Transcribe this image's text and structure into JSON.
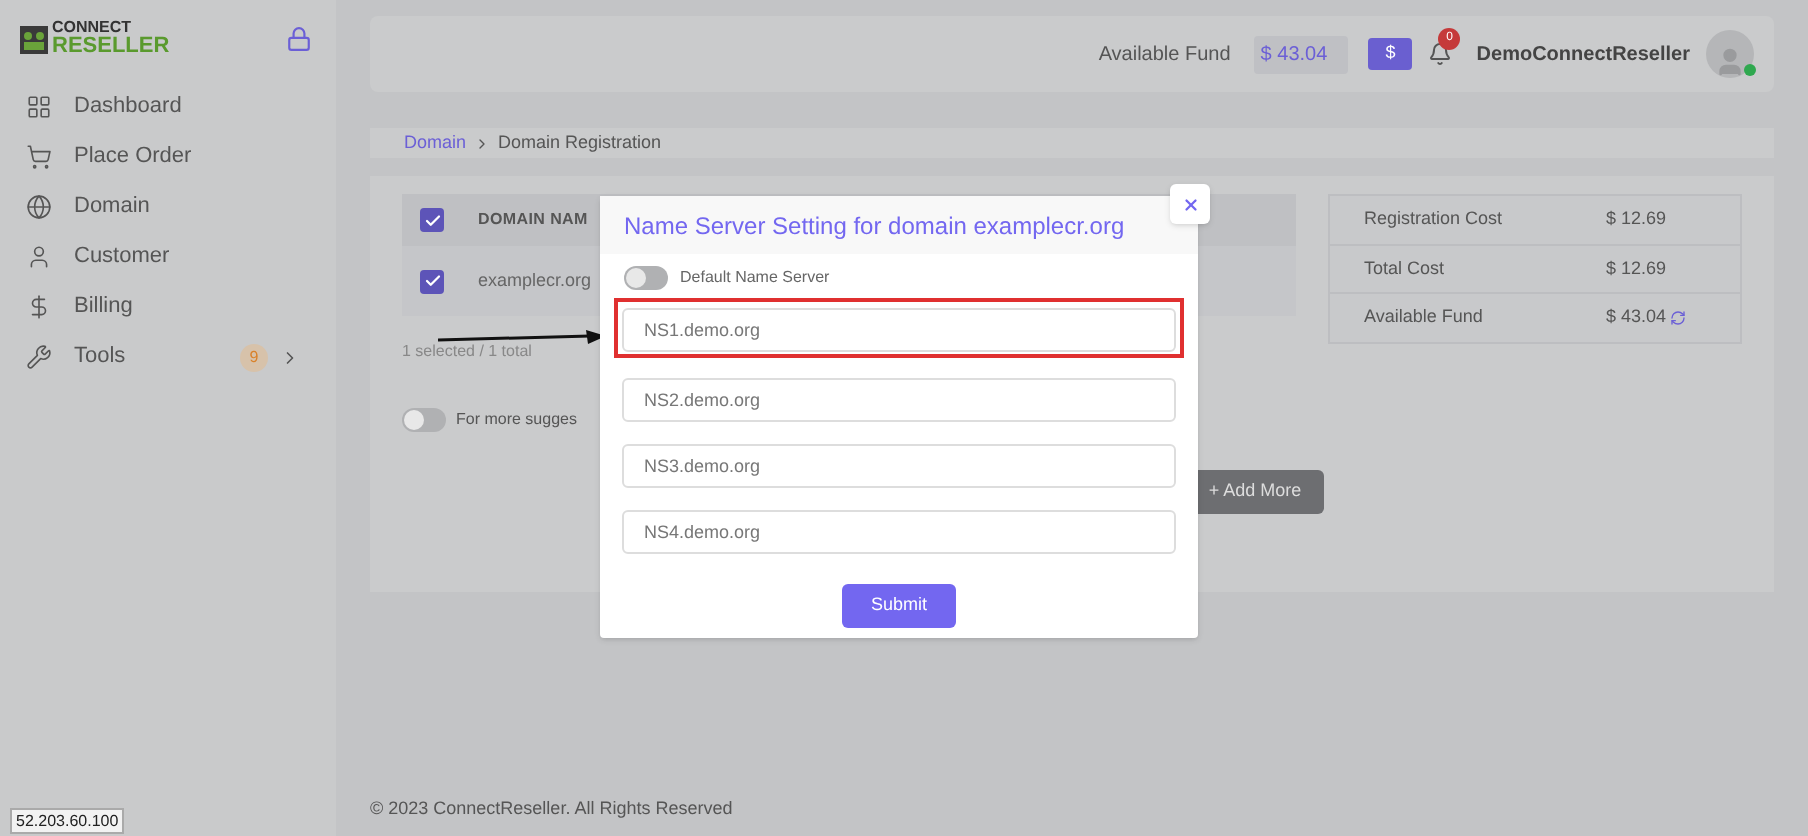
{
  "logo": {
    "top": "CONNECT",
    "bottom": "RESELLER"
  },
  "sidebar": {
    "items": [
      {
        "label": "Dashboard",
        "expandable": false
      },
      {
        "label": "Place Order",
        "expandable": false
      },
      {
        "label": "Domain",
        "expandable": false
      },
      {
        "label": "Customer",
        "expandable": false
      },
      {
        "label": "Billing",
        "expandable": false
      },
      {
        "label": "Tools",
        "badge": "9",
        "expandable": true
      }
    ]
  },
  "header": {
    "fund_label": "Available Fund",
    "fund_value": "$ 43.04",
    "currency_button": "$",
    "notification_count": "0",
    "user": "DemoConnectReseller",
    "online": true
  },
  "breadcrumb": [
    {
      "label": "Domain",
      "link": true
    },
    {
      "label": "Domain Registration",
      "link": false
    }
  ],
  "table": {
    "header_checked": true,
    "column_1": "DOMAIN NAM",
    "rows": [
      {
        "domain": "examplecr.org",
        "checked": true
      }
    ],
    "summary": "1 selected / 1 total"
  },
  "suggestions": {
    "label": "For more sugges",
    "on": false
  },
  "add_more": "+ Add More",
  "costs": [
    {
      "label": "Registration Cost",
      "value": "$ 12.69",
      "refresh": false
    },
    {
      "label": "Total Cost",
      "value": "$ 12.69",
      "refresh": false
    },
    {
      "label": "Available Fund",
      "value": "$ 43.04",
      "refresh": true
    }
  ],
  "footer": "© 2023 ConnectReseller. All Rights Reserved",
  "ip_tooltip": "52.203.60.100",
  "modal": {
    "title": "Name Server Setting for domain examplecr.org",
    "default_ns": {
      "label": "Default Name Server",
      "on": false
    },
    "fields": [
      {
        "placeholder": "NS1.demo.org",
        "highlighted": true
      },
      {
        "placeholder": "NS2.demo.org",
        "highlighted": false
      },
      {
        "placeholder": "NS3.demo.org",
        "highlighted": false
      },
      {
        "placeholder": "NS4.demo.org",
        "highlighted": false
      }
    ],
    "submit": "Submit"
  }
}
